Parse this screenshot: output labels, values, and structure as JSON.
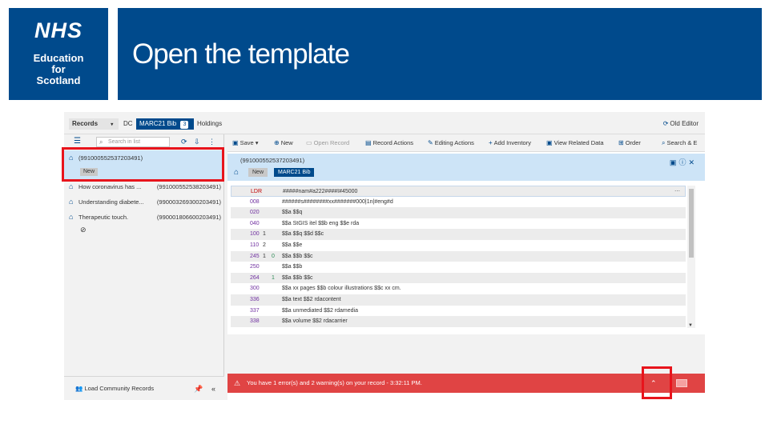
{
  "slide": {
    "logo": {
      "nhs": "NHS",
      "line1": "Education",
      "line2": "for",
      "line3": "Scotland"
    },
    "title": "Open the template"
  },
  "app": {
    "tabs": [
      {
        "label": "Records",
        "icon": "chevron-down-icon"
      },
      {
        "label": "DC"
      },
      {
        "label": "MARC21 Bib",
        "count": "3"
      },
      {
        "label": "Holdings"
      }
    ],
    "old_editor": "Old Editor",
    "left": {
      "search_placeholder": "Search in list",
      "records": [
        {
          "title": "(991000552537203491)",
          "badge": "New",
          "selected": true
        },
        {
          "title": "How coronavirus has ...",
          "id": "(991000552538203491)"
        },
        {
          "title": "Understanding diabete...",
          "id": "(990003269300203491)"
        },
        {
          "title": "Therapeutic touch.",
          "id": "(990001806600203491)"
        }
      ],
      "load_community": "Load Community Records"
    },
    "toolbar": {
      "save": "Save",
      "new": "New",
      "open_record": "Open Record",
      "record_actions": "Record Actions",
      "editing_actions": "Editing Actions",
      "add_inventory": "Add Inventory",
      "view_related": "View Related Data",
      "order": "Order",
      "search": "Search & E"
    },
    "record": {
      "id": "(991000552537203491)",
      "badge_new": "New",
      "badge_type": "MARC21 Bib"
    },
    "marc_rows": [
      {
        "tag": "LDR",
        "i1": "",
        "i2": "",
        "value": "#####nam#a222####I#45000"
      },
      {
        "tag": "008",
        "i1": "",
        "i2": "",
        "value": "######s########xx#######000|1n|#eng#d"
      },
      {
        "tag": "020",
        "i1": "",
        "i2": "",
        "value": "$$a $$q"
      },
      {
        "tag": "040",
        "i1": "",
        "i2": "",
        "value": "$$a StGIS itel $$b eng $$e rda"
      },
      {
        "tag": "100",
        "i1": "1",
        "i2": "",
        "value": "$$a $$q $$d $$c"
      },
      {
        "tag": "110",
        "i1": "2",
        "i2": "",
        "value": "$$a $$e"
      },
      {
        "tag": "245",
        "i1": "1",
        "i2": "0",
        "value": "$$a $$b $$c"
      },
      {
        "tag": "250",
        "i1": "",
        "i2": "",
        "value": "$$a $$b"
      },
      {
        "tag": "264",
        "i1": "",
        "i2": "1",
        "value": "$$a $$b $$c"
      },
      {
        "tag": "300",
        "i1": "",
        "i2": "",
        "value": "$$a xx pages $$b colour illustrations $$c xx cm."
      },
      {
        "tag": "336",
        "i1": "",
        "i2": "",
        "value": "$$a text $$2 rdacontent"
      },
      {
        "tag": "337",
        "i1": "",
        "i2": "",
        "value": "$$a unmediated $$2 rdamedia"
      },
      {
        "tag": "338",
        "i1": "",
        "i2": "",
        "value": "$$a volume $$2 rdacarrier"
      }
    ],
    "error_message": "You have 1 error(s) and 2 warning(s) on your record - 3:32:11 PM.",
    "colors": {
      "brand": "#004a8c",
      "error": "#e04444",
      "highlight": "#e8141c",
      "selected": "#cde4f7"
    }
  }
}
